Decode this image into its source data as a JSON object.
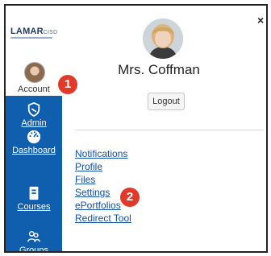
{
  "brand": {
    "logo_text": "LAMAR",
    "logo_suffix": "CISD"
  },
  "nav": {
    "account_label": "Account",
    "items": [
      {
        "label": "Admin",
        "icon": "shield-icon"
      },
      {
        "label": "Dashboard",
        "icon": "dashboard-icon"
      },
      {
        "label": "Courses",
        "icon": "book-icon"
      },
      {
        "label": "Groups",
        "icon": "groups-icon"
      }
    ]
  },
  "tray": {
    "user_name": "Mrs. Coffman",
    "logout_label": "Logout",
    "close_icon": "×",
    "links": [
      "Notifications",
      "Profile",
      "Files",
      "Settings",
      "ePortfolios",
      "Redirect Tool"
    ]
  },
  "markers": {
    "first": "1",
    "second": "2"
  },
  "colors": {
    "nav_blue": "#0f5fae",
    "link_blue": "#0f4fa8",
    "marker_red": "#e03a2a"
  }
}
